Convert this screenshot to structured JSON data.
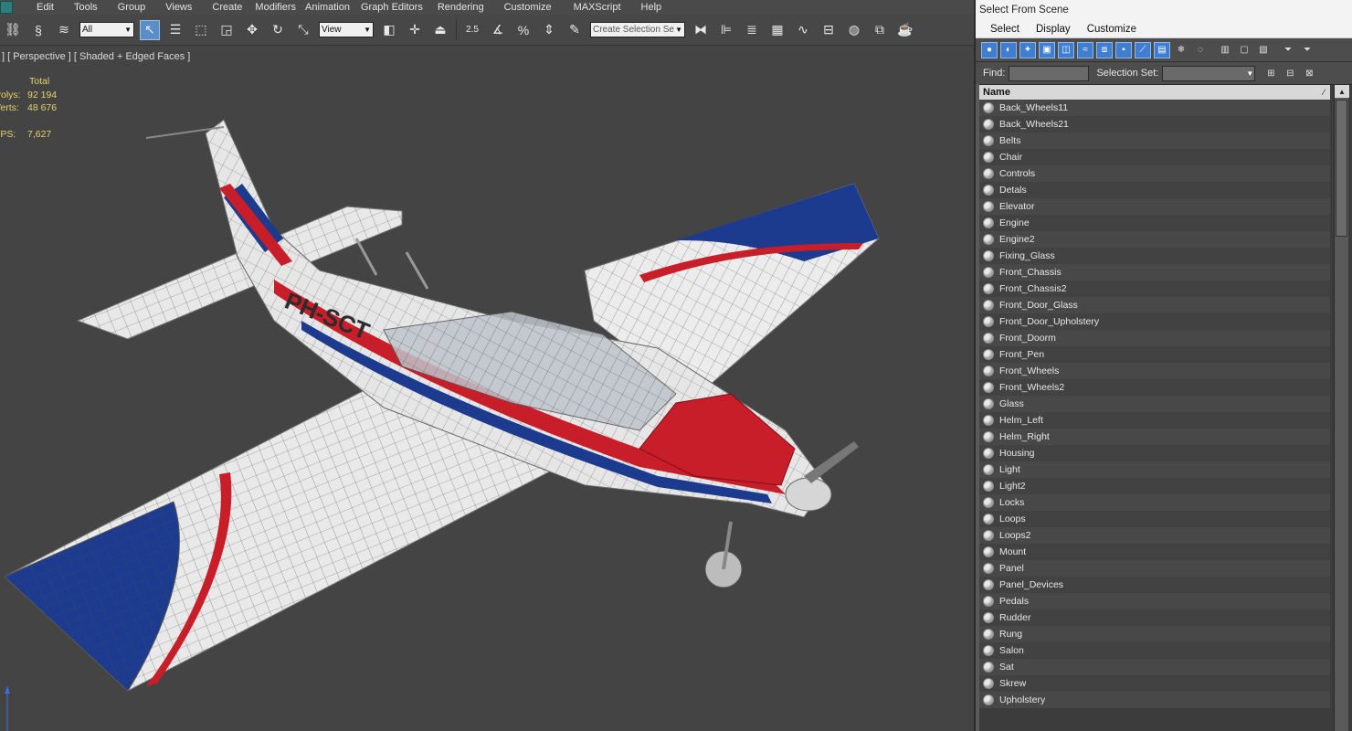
{
  "menu": [
    "Edit",
    "Tools",
    "Group",
    "Views",
    "Create",
    "Modifiers",
    "Animation",
    "Graph Editors",
    "Rendering",
    "Customize",
    "MAXScript",
    "Help"
  ],
  "toolbar": {
    "filter_value": "All",
    "refcoord_value": "View",
    "selection_set_placeholder": "Create Selection Se",
    "snap_angle_label": "2.5"
  },
  "viewport": {
    "label": "] [ Perspective ] [ Shaded + Edged Faces ]",
    "stats": {
      "header": "Total",
      "polys_label": "Polys:",
      "polys_value": "92 194",
      "verts_label": "Verts:",
      "verts_value": "48 676",
      "fps_label": "FPS:",
      "fps_value": "7,627"
    },
    "tail_number": "PH-SCT"
  },
  "dialog": {
    "title": "Select From Scene",
    "menu": [
      "Select",
      "Display",
      "Customize"
    ],
    "find_label": "Find:",
    "selection_set_label": "Selection Set:",
    "column_header": "Name",
    "objects": [
      "Back_Wheels11",
      "Back_Wheels21",
      "Belts",
      "Chair",
      "Controls",
      "Detals",
      "Elevator",
      "Engine",
      "Engine2",
      "Fixing_Glass",
      "Front_Chassis",
      "Front_Chassis2",
      "Front_Door_Glass",
      "Front_Door_Upholstery",
      "Front_Doorm",
      "Front_Pen",
      "Front_Wheels",
      "Front_Wheels2",
      "Glass",
      "Helm_Left",
      "Helm_Right",
      "Housing",
      "Light",
      "Light2",
      "Locks",
      "Loops",
      "Loops2",
      "Mount",
      "Panel",
      "Panel_Devices",
      "Pedals",
      "Rudder",
      "Rung",
      "Salon",
      "Sat",
      "Skrew",
      "Upholstery"
    ]
  }
}
